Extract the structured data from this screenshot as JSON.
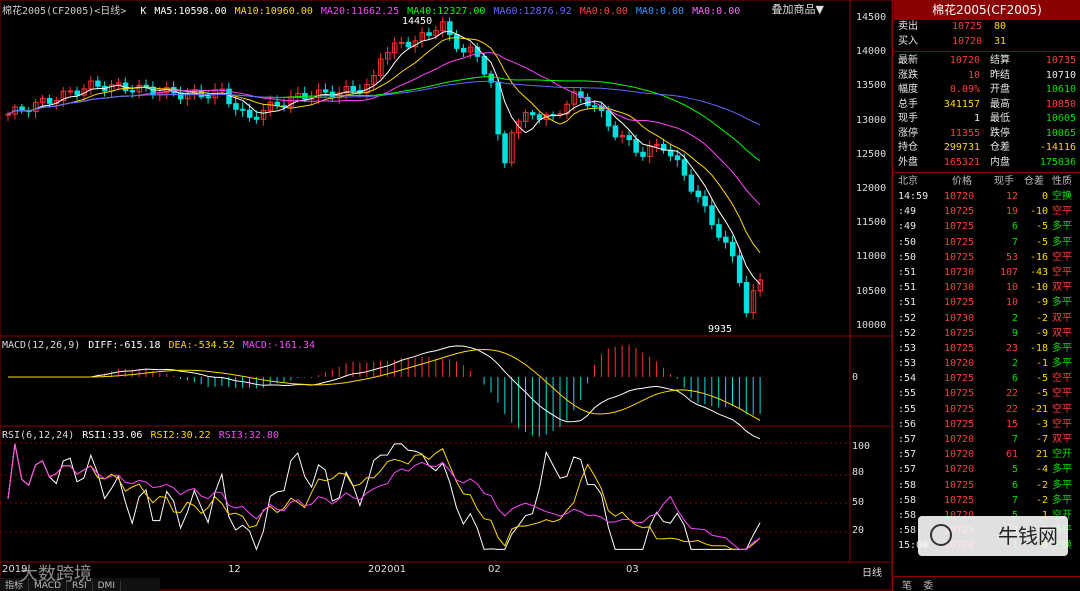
{
  "window": {
    "symbol_header": "棉花2005(CF2005)<日线>",
    "overlay_button": "叠加商品▼"
  },
  "ma_legend": [
    {
      "text": "K",
      "color": "#ffffff"
    },
    {
      "text": "MA5:10598.00",
      "color": "#ffffff"
    },
    {
      "text": "MA10:10960.00",
      "color": "#ffd700"
    },
    {
      "text": "MA20:11662.25",
      "color": "#ff44ff"
    },
    {
      "text": "MA40:12327.00",
      "color": "#00ff00"
    },
    {
      "text": "MA60:12876.92",
      "color": "#6666ff"
    },
    {
      "text": "MA0:0.00",
      "color": "#ff4444"
    },
    {
      "text": "MA0:0.00",
      "color": "#3399ff"
    },
    {
      "text": "MA0:0.00",
      "color": "#ff66ff"
    }
  ],
  "price_axis": [
    "14500",
    "14000",
    "13500",
    "13000",
    "12500",
    "12000",
    "11500",
    "11000",
    "10500",
    "10000"
  ],
  "annotations": {
    "high": "14450",
    "low": "9935"
  },
  "macd": {
    "legend": [
      {
        "text": "MACD(12,26,9)",
        "color": "#dddddd"
      },
      {
        "text": "DIFF:-615.18",
        "color": "#ffffff"
      },
      {
        "text": "DEA:-534.52",
        "color": "#ffd700"
      },
      {
        "text": "MACD:-161.34",
        "color": "#ff44ff"
      }
    ],
    "axis": [
      "0"
    ]
  },
  "rsi": {
    "legend": [
      {
        "text": "RSI(6,12,24)",
        "color": "#dddddd"
      },
      {
        "text": "RSI1:33.06",
        "color": "#ffffff"
      },
      {
        "text": "RSI2:30.22",
        "color": "#ffd700"
      },
      {
        "text": "RSI3:32.80",
        "color": "#ff44ff"
      }
    ],
    "axis": [
      "100",
      "80",
      "50",
      "20"
    ]
  },
  "x_axis": {
    "labels": [
      "2019",
      "12",
      "202001",
      "02",
      "03"
    ],
    "right_label": "日线"
  },
  "bottom_tabs": [
    "指标",
    "MACD",
    "RSI",
    "DMI"
  ],
  "panel": {
    "title": "棉花2005(CF2005)",
    "orders": [
      {
        "label": "卖出",
        "price": "10725",
        "qty": "80"
      },
      {
        "label": "买入",
        "price": "10720",
        "qty": "31"
      }
    ],
    "quote": [
      {
        "l1": "最新",
        "v1": "10720",
        "c1": "red",
        "l2": "结算",
        "v2": "10735",
        "c2": "red"
      },
      {
        "l1": "涨跌",
        "v1": "10",
        "c1": "red",
        "l2": "昨结",
        "v2": "10710",
        "c2": "white"
      },
      {
        "l1": "幅度",
        "v1": "0.09%",
        "c1": "red",
        "l2": "开盘",
        "v2": "10610",
        "c2": "green"
      },
      {
        "l1": "总手",
        "v1": "341157",
        "c1": "yel",
        "l2": "最高",
        "v2": "10850",
        "c2": "red"
      },
      {
        "l1": "现手",
        "v1": "1",
        "c1": "white",
        "l2": "最低",
        "v2": "10605",
        "c2": "green"
      },
      {
        "l1": "涨停",
        "v1": "11355",
        "c1": "red",
        "l2": "跌停",
        "v2": "10065",
        "c2": "green"
      },
      {
        "l1": "持仓",
        "v1": "299731",
        "c1": "yel",
        "l2": "仓差",
        "v2": "-14116",
        "c2": "yel"
      },
      {
        "l1": "外盘",
        "v1": "165321",
        "c1": "red",
        "l2": "内盘",
        "v2": "175836",
        "c2": "green"
      }
    ],
    "tick_header": [
      "北京",
      "价格",
      "现手",
      "仓差",
      "性质"
    ],
    "ticks": [
      {
        "t": "14:59",
        "p": "10720",
        "v": "12",
        "d": "0",
        "n": "空换",
        "nc": "green"
      },
      {
        "t": ":49",
        "p": "10725",
        "v": "19",
        "d": "-10",
        "n": "空平",
        "nc": "red"
      },
      {
        "t": ":49",
        "p": "10725",
        "v": "6",
        "d": "-5",
        "n": "多平",
        "nc": "green"
      },
      {
        "t": ":50",
        "p": "10725",
        "v": "7",
        "d": "-5",
        "n": "多平",
        "nc": "green"
      },
      {
        "t": ":50",
        "p": "10725",
        "v": "53",
        "d": "-16",
        "n": "空平",
        "nc": "red"
      },
      {
        "t": ":51",
        "p": "10730",
        "v": "107",
        "d": "-43",
        "n": "空平",
        "nc": "red"
      },
      {
        "t": ":51",
        "p": "10730",
        "v": "10",
        "d": "-10",
        "n": "双平",
        "nc": "red"
      },
      {
        "t": ":51",
        "p": "10725",
        "v": "10",
        "d": "-9",
        "n": "多平",
        "nc": "green"
      },
      {
        "t": ":52",
        "p": "10730",
        "v": "2",
        "d": "-2",
        "n": "双平",
        "nc": "red"
      },
      {
        "t": ":52",
        "p": "10725",
        "v": "9",
        "d": "-9",
        "n": "双平",
        "nc": "red"
      },
      {
        "t": ":53",
        "p": "10725",
        "v": "23",
        "d": "-18",
        "n": "多平",
        "nc": "green"
      },
      {
        "t": ":53",
        "p": "10720",
        "v": "2",
        "d": "-1",
        "n": "多平",
        "nc": "green"
      },
      {
        "t": ":54",
        "p": "10725",
        "v": "6",
        "d": "-5",
        "n": "空平",
        "nc": "red"
      },
      {
        "t": ":55",
        "p": "10725",
        "v": "22",
        "d": "-5",
        "n": "空平",
        "nc": "red"
      },
      {
        "t": ":55",
        "p": "10725",
        "v": "22",
        "d": "-21",
        "n": "空平",
        "nc": "red"
      },
      {
        "t": ":56",
        "p": "10725",
        "v": "15",
        "d": "-3",
        "n": "空平",
        "nc": "red"
      },
      {
        "t": ":57",
        "p": "10720",
        "v": "7",
        "d": "-7",
        "n": "双平",
        "nc": "red"
      },
      {
        "t": ":57",
        "p": "10720",
        "v": "61",
        "d": "21",
        "n": "空开",
        "nc": "green"
      },
      {
        "t": ":57",
        "p": "10720",
        "v": "5",
        "d": "-4",
        "n": "多平",
        "nc": "green"
      },
      {
        "t": ":58",
        "p": "10725",
        "v": "6",
        "d": "-2",
        "n": "多平",
        "nc": "green"
      },
      {
        "t": ":58",
        "p": "10725",
        "v": "7",
        "d": "-2",
        "n": "多平",
        "nc": "green"
      },
      {
        "t": ":58",
        "p": "10720",
        "v": "5",
        "d": "1",
        "n": "空开",
        "nc": "green"
      },
      {
        "t": ":58",
        "p": "10725",
        "v": "3",
        "d": "-3",
        "n": "多平",
        "nc": "green"
      },
      {
        "t": "15:00",
        "p": "10720",
        "v": "1",
        "d": "0",
        "n": "空换",
        "nc": "green"
      }
    ],
    "footer": [
      "笔",
      "委"
    ]
  },
  "watermarks": {
    "right": "牛钱网",
    "left": "大数跨境"
  }
}
